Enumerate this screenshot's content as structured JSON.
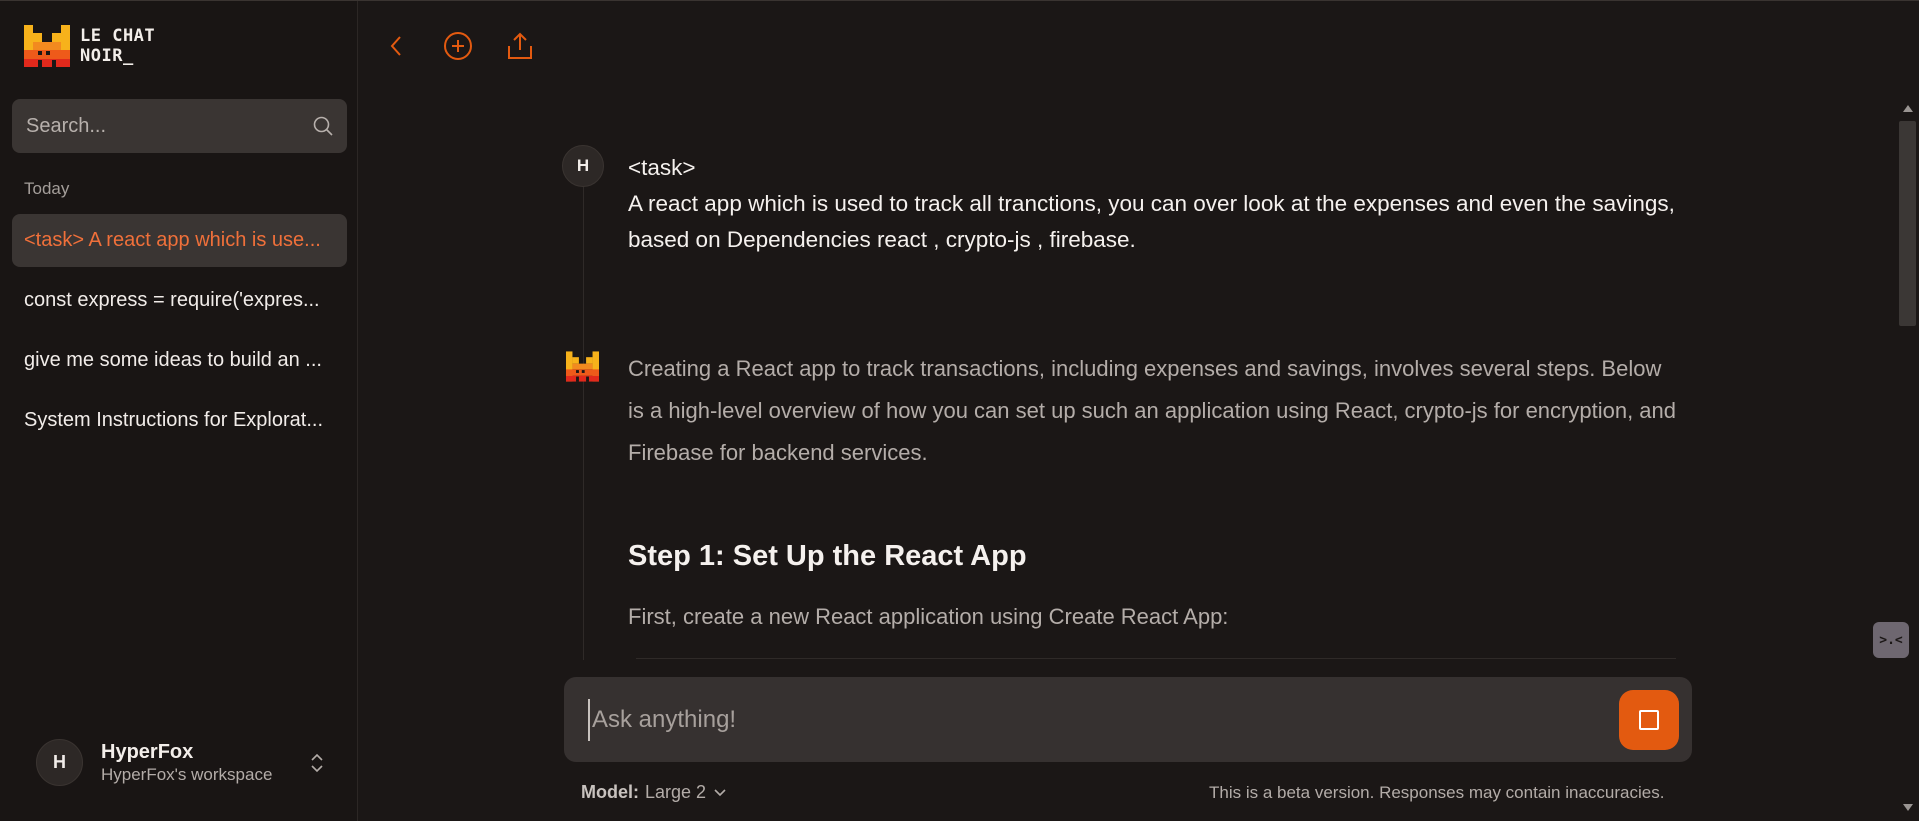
{
  "app": {
    "brand_line1": "LE CHAT",
    "brand_line2": "NOIR_",
    "accent_color": "#e35a10",
    "bg_color": "#1b1716"
  },
  "sidebar": {
    "search_placeholder": "Search...",
    "section_label": "Today",
    "history": [
      {
        "label": "<task> A react app which is use...",
        "active": true
      },
      {
        "label": "const express = require('expres...",
        "active": false
      },
      {
        "label": "give me some ideas to build an ...",
        "active": false
      },
      {
        "label": "System Instructions for Explorat...",
        "active": false
      }
    ],
    "user": {
      "initial": "H",
      "name": "HyperFox",
      "workspace": "HyperFox's workspace"
    }
  },
  "toolbar": {
    "icons": [
      "back-chevron-icon",
      "new-chat-plus-icon",
      "share-upload-icon"
    ]
  },
  "conversation": {
    "user_message": {
      "avatar_initial": "H",
      "line1": "<task>",
      "body": "A react app which is used to track all tranctions, you can over look at the expenses and even the savings, based on Dependencies react , crypto-js , firebase."
    },
    "assistant_message": {
      "intro": "Creating a React app to track transactions, including expenses and savings, involves several steps. Below is a high-level overview of how you can set up such an application using React, crypto-js for encryption, and Firebase for backend services.",
      "heading": "Step 1: Set Up the React App",
      "para": "First, create a new React application using Create React App:"
    }
  },
  "composer": {
    "placeholder": "Ask anything!",
    "model_label": "Model:",
    "model_value": "Large 2",
    "disclaimer": "This is a beta version. Responses may contain inaccuracies."
  },
  "side_widget": {
    "label": ">.<"
  }
}
